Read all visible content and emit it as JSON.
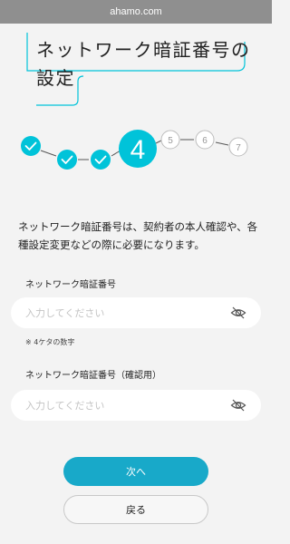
{
  "browser": {
    "url": "ahamo.com"
  },
  "page": {
    "title_line1": "ネットワーク暗証番号の",
    "title_line2": "設定",
    "intro": "ネットワーク暗証番号は、契約者の本人確認や、各種設定変更などの際に必要になります。"
  },
  "steps": {
    "current": "4",
    "upcoming": [
      "5",
      "6",
      "7"
    ],
    "completed_count": 3
  },
  "form": {
    "pin": {
      "label": "ネットワーク暗証番号",
      "placeholder": "入力してください",
      "value": "",
      "note": "※ 4ケタの数字",
      "toggle_icon": "eye-slash-icon"
    },
    "pin_confirm": {
      "label": "ネットワーク暗証番号（確認用）",
      "placeholder": "入力してください",
      "value": "",
      "toggle_icon": "eye-slash-icon"
    }
  },
  "buttons": {
    "next": "次へ",
    "back": "戻る"
  },
  "colors": {
    "accent": "#18a9c9",
    "active_step": "#00c3d9",
    "upcoming_step": "#bdbdbd",
    "background": "#f3f3f3",
    "url_bar": "#8f8f8f"
  }
}
